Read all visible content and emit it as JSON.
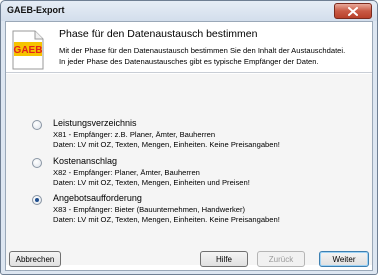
{
  "window": {
    "title": "GAEB-Export"
  },
  "logo": {
    "text": "GAEB"
  },
  "header": {
    "title": "Phase für den Datenaustausch bestimmen",
    "desc_line1": "Mit der Phase für den Datenaustausch bestimmen Sie den Inhalt der Austauschdatei.",
    "desc_line2": "In jeder Phase des Datenaustausches gibt es typische Empfänger der Daten."
  },
  "options": [
    {
      "label": "Leistungsverzeichnis",
      "line1": "X81 - Empfänger: z.B. Planer, Ämter, Bauherren",
      "line2": "Daten: LV mit OZ, Texten, Mengen, Einheiten. Keine Preisangaben!",
      "selected": false
    },
    {
      "label": "Kostenanschlag",
      "line1": "X82 - Empfänger: Planer, Ämter, Bauherren",
      "line2": "Daten: LV mit OZ, Texten, Mengen, Einheiten und Preisen!",
      "selected": false
    },
    {
      "label": "Angebotsaufforderung",
      "line1": "X83 - Empfänger: Bieter (Bauunternehmen, Handwerker)",
      "line2": "Daten: LV mit OZ, Texten, Mengen, Einheiten. Keine Preisangaben!",
      "selected": true
    }
  ],
  "buttons": {
    "cancel": "Abbrechen",
    "help": "Hilfe",
    "back": "Zurück",
    "next": "Weiter"
  },
  "icons": {
    "close": "close-icon",
    "logo": "gaeb-logo-icon"
  },
  "colors": {
    "logo_red": "#e2231a",
    "logo_yellow": "#f5c400",
    "window_frame": "#dde6f1"
  }
}
